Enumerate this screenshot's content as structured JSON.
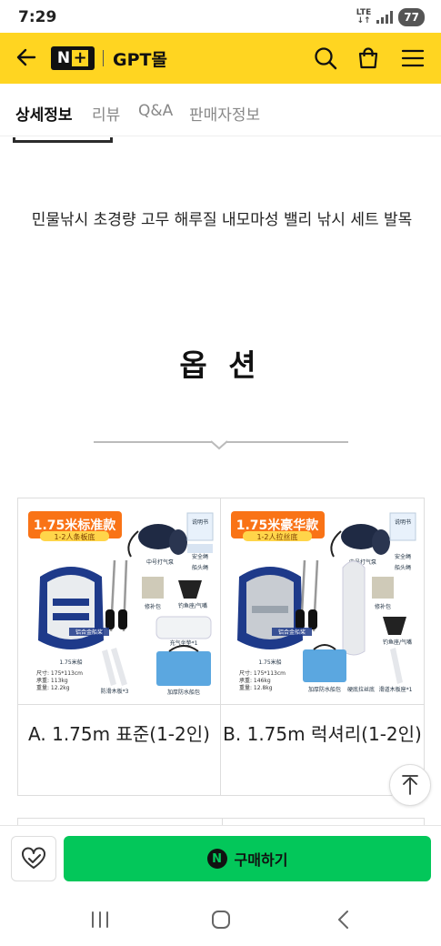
{
  "status_bar": {
    "time": "7:29",
    "network": "LTE",
    "battery": "77"
  },
  "header": {
    "logo_text": "N",
    "brand": "GPT몰"
  },
  "tabs": [
    {
      "label": "상세정보",
      "active": true
    },
    {
      "label": "리뷰",
      "active": false
    },
    {
      "label": "Q&A",
      "active": false
    },
    {
      "label": "판매자정보",
      "active": false
    }
  ],
  "content": {
    "product_title": "민물낚시 초경량 고무 해루질 내모마성 밸리 낚시 세트 발목",
    "option_heading": "옵 션",
    "options": [
      {
        "label": "A. 1.75m 표준(1-2인)",
        "image": {
          "title": "1.75米标准款",
          "subtitle": "1-2人条板底",
          "labels": [
            "说明书",
            "安全绳",
            "船头绳",
            "中号打气泵",
            "修补包",
            "钓鱼座/气嘴",
            "铝合金船桨",
            "1.75米船",
            "充气坐垫*1",
            "防滑木板*3",
            "加厚防水船包"
          ],
          "specs": [
            "尺寸: 175*113cm",
            "承重: 113kg",
            "重量: 12.2kg"
          ],
          "color": "#1E3A8A"
        }
      },
      {
        "label": "B. 1.75m 럭셔리(1-2인)",
        "image": {
          "title": "1.75米豪华款",
          "subtitle": "1-2人拉丝底",
          "labels": [
            "说明书",
            "安全绳",
            "船头绳",
            "中号打气泵",
            "修补包",
            "钓鱼座/气嘴",
            "铝合金船桨",
            "1.75米船",
            "加厚防水船包",
            "硬底拉丝底",
            "滑道木板座*1"
          ],
          "specs": [
            "尺寸: 175*113cm",
            "承重: 146kg",
            "重量: 12.8kg"
          ],
          "color": "#1E3A8A"
        }
      }
    ]
  },
  "buy_bar": {
    "buy_label": "구매하기",
    "npay_icon": "N"
  },
  "colors": {
    "header_bg": "#FFD521",
    "buy_green": "#03C75A",
    "boat_blue": "#1E3A8A",
    "banner_orange": "#F97316"
  }
}
